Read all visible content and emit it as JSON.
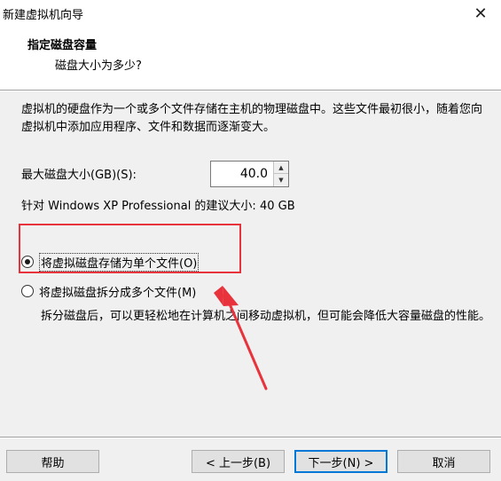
{
  "window": {
    "title": "新建虚拟机向导"
  },
  "header": {
    "heading": "指定磁盘容量",
    "subheading": "磁盘大小为多少?"
  },
  "description": "虚拟机的硬盘作为一个或多个文件存储在主机的物理磁盘中。这些文件最初很小，随着您向虚拟机中添加应用程序、文件和数据而逐渐变大。",
  "disk_size": {
    "label": "最大磁盘大小(GB)(S):",
    "value": "40.0"
  },
  "recommended": "针对 Windows XP Professional 的建议大小: 40 GB",
  "options": [
    {
      "label": "将虚拟磁盘存储为单个文件(O)",
      "checked": true
    },
    {
      "label": "将虚拟磁盘拆分成多个文件(M)",
      "checked": false
    }
  ],
  "split_note": "拆分磁盘后，可以更轻松地在计算机之间移动虚拟机，但可能会降低大容量磁盘的性能。",
  "buttons": {
    "help": "帮助",
    "back": "< 上一步(B)",
    "next": "下一步(N) >",
    "cancel": "取消"
  },
  "colors": {
    "annotation": "#e8323c",
    "default_button_border": "#0078d7"
  }
}
